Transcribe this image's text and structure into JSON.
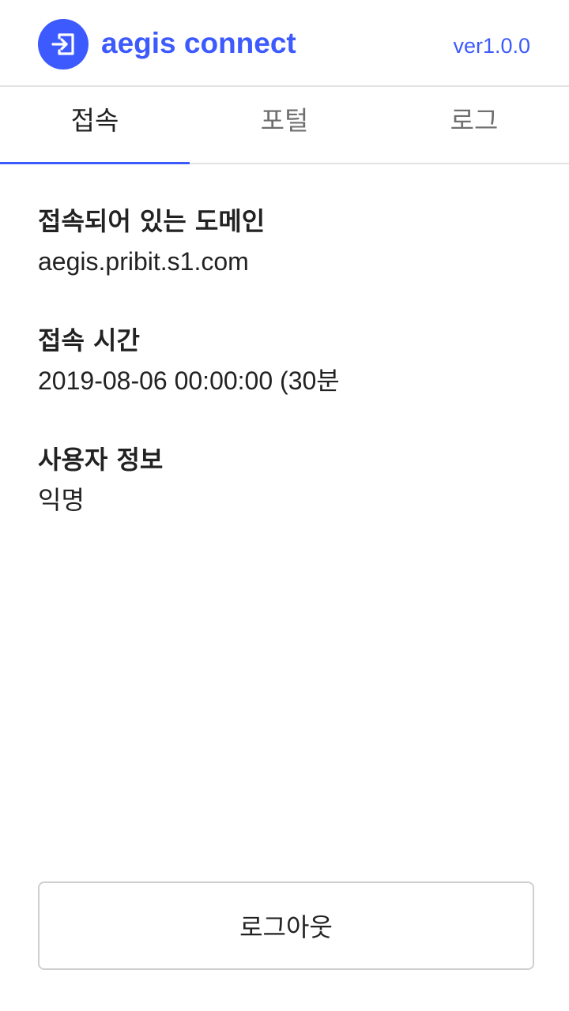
{
  "header": {
    "title": "aegis connect",
    "version": "ver1.0.0",
    "logo_icon": "login-arrow-icon",
    "accent_color": "#3d5afe"
  },
  "tabs": [
    {
      "label": "접속",
      "active": true
    },
    {
      "label": "포털",
      "active": false
    },
    {
      "label": "로그",
      "active": false
    }
  ],
  "main": {
    "domain": {
      "label": "접속되어 있는 도메인",
      "value": "aegis.pribit.s1.com"
    },
    "time": {
      "label": "접속 시간",
      "value": "2019-08-06 00:00:00 (30분"
    },
    "user": {
      "label": "사용자 정보",
      "value": "익명"
    }
  },
  "logout": {
    "label": "로그아웃"
  }
}
